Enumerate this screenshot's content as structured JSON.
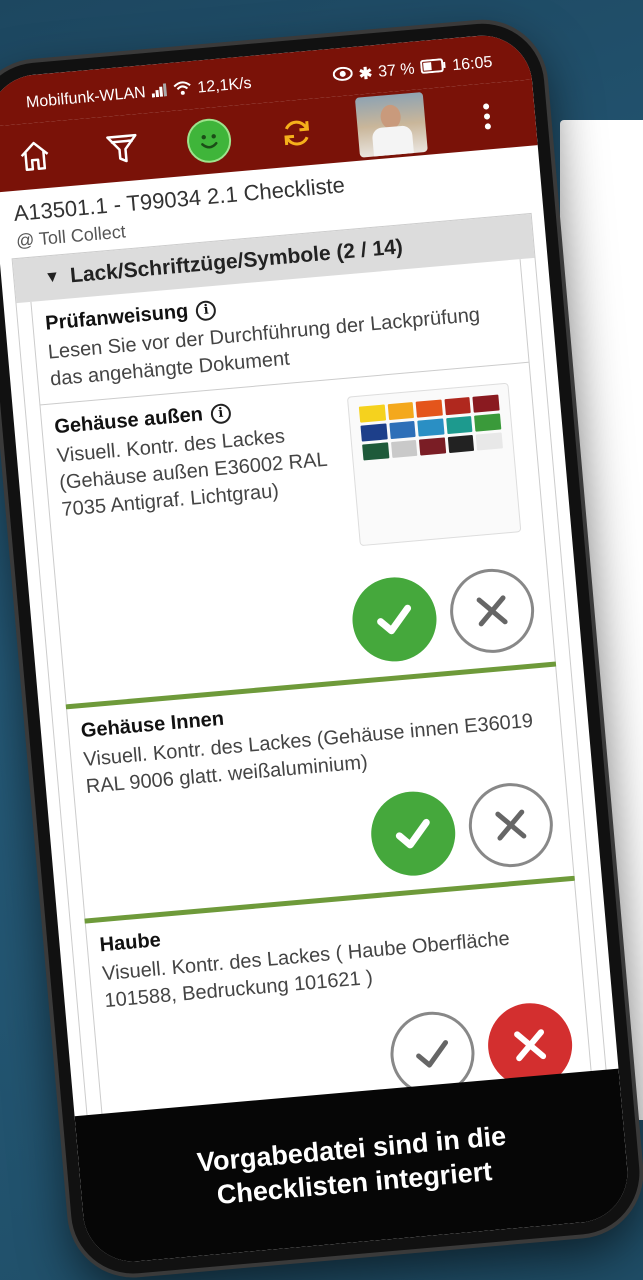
{
  "status_bar": {
    "carrier": "Mobilfunk-WLAN",
    "speed": "12,1K/s",
    "battery": "37 %",
    "time": "16:05"
  },
  "toolbar": {
    "icons": [
      "home-icon",
      "filter-icon",
      "smiley-status-icon",
      "sync-icon",
      "avatar",
      "more-icon"
    ]
  },
  "header": {
    "title": "A13501.1 - T99034 2.1 Checkliste",
    "subtitle": "@ Toll Collect"
  },
  "section": {
    "label": "Lack/Schriftzüge/Symbole (2 / 14)"
  },
  "items": [
    {
      "title": "Prüfanweisung",
      "text": "Lesen Sie vor der Durchführung der Lackprüfung das angehängte Dokument"
    },
    {
      "title": "Gehäuse außen",
      "text": "Visuell. Kontr. des Lackes (Gehäuse außen E36002 RAL 7035 Antigraf. Lichtgrau)",
      "state": "ok"
    },
    {
      "title": "Gehäuse Innen",
      "text": "Visuell. Kontr. des Lackes (Gehäuse innen E36019 RAL 9006 glatt. weißaluminium)",
      "state": "ok"
    },
    {
      "title": "Haube",
      "text": "Visuell. Kontr. des Lackes ( Haube Oberfläche 101588, Bedruckung 101621 )",
      "state": "not-ok"
    }
  ],
  "caption": "Vorgabedatei sind in die Checklisten integriert",
  "colors": {
    "header_bg": "#7a1208",
    "ok_green": "#45a83c",
    "fail_red": "#d32f2f",
    "sync_orange": "#f5b01b"
  }
}
